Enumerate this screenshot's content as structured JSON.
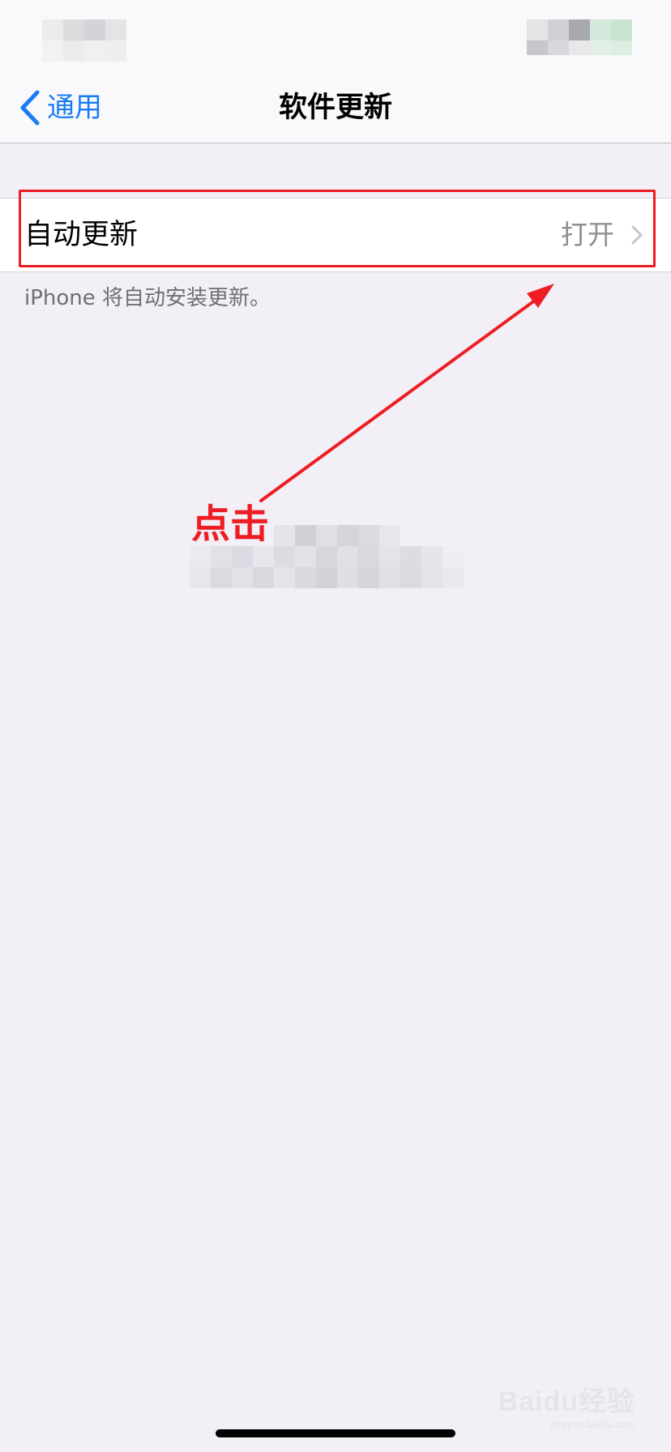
{
  "nav": {
    "back_label": "通用",
    "title": "软件更新"
  },
  "settings": {
    "auto_update": {
      "label": "自动更新",
      "value": "打开"
    },
    "footer_note": "iPhone 将自动安装更新。"
  },
  "annotation": {
    "text": "点击",
    "color": "#ee1d24"
  },
  "watermark": {
    "text": "Baidu经验",
    "sub": "jingyan.baidu.com"
  },
  "colors": {
    "accent": "#1a7cf4",
    "annotation": "#ee1d24",
    "background": "#f2eff6"
  },
  "icons": {
    "back": "chevron-left-icon",
    "disclosure": "chevron-right-icon"
  }
}
